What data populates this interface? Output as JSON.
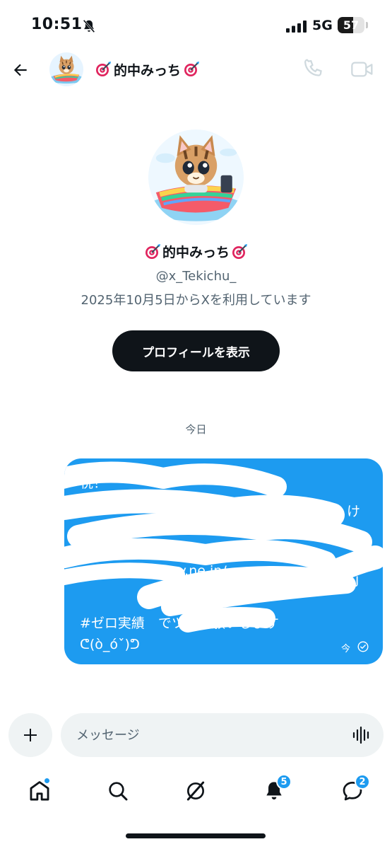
{
  "status_bar": {
    "time": "10:51",
    "network": "5G",
    "battery": "57",
    "battery_level": 0.57
  },
  "header": {
    "display_name": "的中みっち",
    "name_emoji": "dart-target"
  },
  "profile": {
    "display_name": "的中みっち",
    "handle": "@x_Tekichu_",
    "joined": "2025年10月5日からXを利用しています",
    "view_profile_label": "プロフィールを表示"
  },
  "conversation": {
    "date_divider": "今日",
    "message": {
      "lines": [
        "祝！",
        "け",
        "ay.ne.jp/",
        "j",
        "#ゼロ実績　でツ　お願いします",
        "ᕦ(ò_óˇ)ᕤ"
      ],
      "time": "今",
      "status": "sent",
      "redacted": true
    }
  },
  "composer": {
    "placeholder": "メッセージ"
  },
  "nav": {
    "items": [
      "home",
      "search",
      "grok",
      "notifications",
      "messages"
    ],
    "notifications_badge": "5",
    "messages_badge": "2"
  },
  "colors": {
    "accent": "#1d9bf0",
    "text": "#0f1419",
    "secondary_text": "#536471",
    "input_bg": "#eff3f4"
  }
}
